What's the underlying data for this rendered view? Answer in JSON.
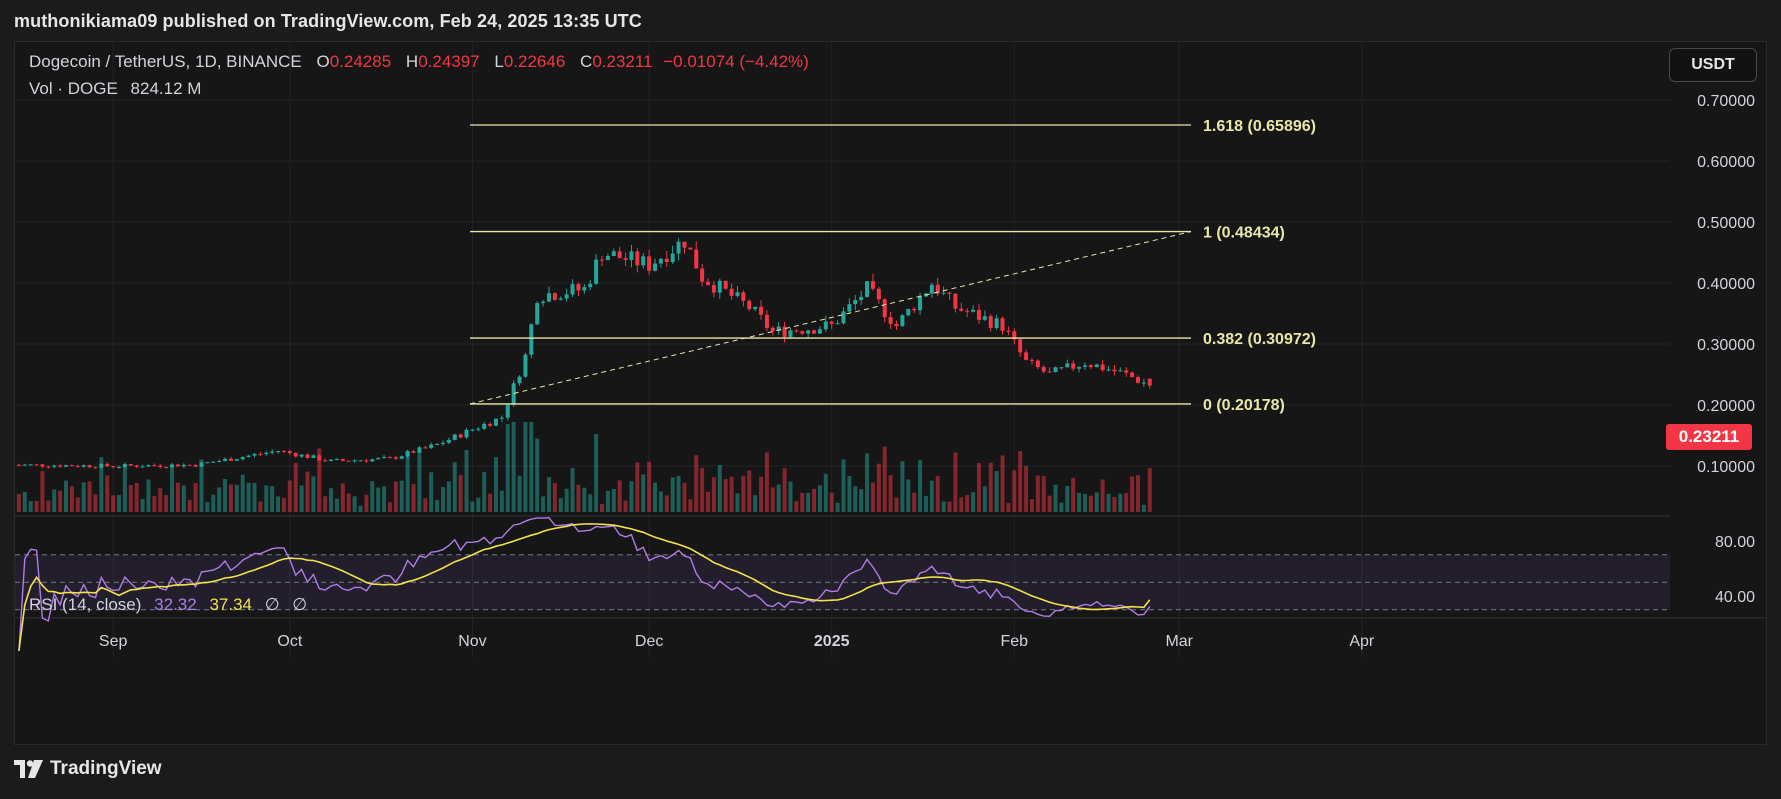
{
  "header": {
    "publish_line": "muthonikiama09 published on TradingView.com, Feb 24, 2025 13:35 UTC"
  },
  "legend": {
    "symbol": "Dogecoin / TetherUS, 1D, BINANCE",
    "open_label": "O",
    "open": "0.24285",
    "high_label": "H",
    "high": "0.24397",
    "low_label": "L",
    "low": "0.22646",
    "close_label": "C",
    "close": "0.23211",
    "change": "−0.01074 (−4.42%)",
    "vol_label": "Vol · DOGE",
    "vol_value": "824.12 M"
  },
  "currency_button": "USDT",
  "last_price": "0.23211",
  "price_axis": [
    "0.70000",
    "0.60000",
    "0.50000",
    "0.40000",
    "0.30000",
    "0.20000",
    "0.10000"
  ],
  "rsi": {
    "label": "RSI (14, close)",
    "value": "32.32",
    "ma": "37.34",
    "extra1": "∅",
    "extra2": "∅",
    "axis": [
      "80.00",
      "40.00"
    ]
  },
  "time_axis": [
    "Sep",
    "Oct",
    "Nov",
    "Dec",
    "2025",
    "Feb",
    "Mar",
    "Apr"
  ],
  "fib_levels": [
    {
      "ratio": "1.618",
      "label": "1.618 (0.65896)",
      "price": 0.65896
    },
    {
      "ratio": "1",
      "label": "1 (0.48434)",
      "price": 0.48434
    },
    {
      "ratio": "0.382",
      "label": "0.382 (0.30972)",
      "price": 0.30972
    },
    {
      "ratio": "0",
      "label": "0 (0.20178)",
      "price": 0.20178
    }
  ],
  "colors": {
    "up": "#26a69a",
    "down": "#f23645",
    "fib": "#e8e6a8",
    "rsi": "#b07ce6",
    "rsi_ma": "#f0e34b"
  },
  "footer": {
    "brand": "TradingView"
  },
  "chart_data": {
    "type": "candlestick",
    "title": "Dogecoin / TetherUS, 1D, BINANCE",
    "ylim": [
      0.02,
      0.72
    ],
    "price_path": [
      {
        "date": "2024-08-15",
        "price": 0.102
      },
      {
        "date": "2024-09-01",
        "price": 0.1
      },
      {
        "date": "2024-09-15",
        "price": 0.102
      },
      {
        "date": "2024-09-29",
        "price": 0.125
      },
      {
        "date": "2024-10-08",
        "price": 0.108
      },
      {
        "date": "2024-10-18",
        "price": 0.112
      },
      {
        "date": "2024-10-26",
        "price": 0.135
      },
      {
        "date": "2024-11-01",
        "price": 0.16
      },
      {
        "date": "2024-11-06",
        "price": 0.18
      },
      {
        "date": "2024-11-10",
        "price": 0.28
      },
      {
        "date": "2024-11-12",
        "price": 0.38
      },
      {
        "date": "2024-11-20",
        "price": 0.39
      },
      {
        "date": "2024-11-23",
        "price": 0.45
      },
      {
        "date": "2024-12-01",
        "price": 0.43
      },
      {
        "date": "2024-12-07",
        "price": 0.47
      },
      {
        "date": "2024-12-10",
        "price": 0.41
      },
      {
        "date": "2024-12-18",
        "price": 0.36
      },
      {
        "date": "2024-12-22",
        "price": 0.32
      },
      {
        "date": "2025-01-01",
        "price": 0.33
      },
      {
        "date": "2025-01-07",
        "price": 0.39
      },
      {
        "date": "2025-01-12",
        "price": 0.33
      },
      {
        "date": "2025-01-18",
        "price": 0.4
      },
      {
        "date": "2025-01-22",
        "price": 0.36
      },
      {
        "date": "2025-01-30",
        "price": 0.33
      },
      {
        "date": "2025-02-03",
        "price": 0.27
      },
      {
        "date": "2025-02-07",
        "price": 0.25
      },
      {
        "date": "2025-02-13",
        "price": 0.27
      },
      {
        "date": "2025-02-20",
        "price": 0.25
      },
      {
        "date": "2025-02-24",
        "price": 0.232
      }
    ],
    "last": {
      "date": "2025-02-24",
      "open": 0.24285,
      "high": 0.24397,
      "low": 0.22646,
      "close": 0.23211,
      "volume": "824.12 M"
    },
    "fibonacci": [
      {
        "ratio": "1.618",
        "price": 0.65896
      },
      {
        "ratio": "1",
        "price": 0.48434
      },
      {
        "ratio": "0.382",
        "price": 0.30972
      },
      {
        "ratio": "0",
        "price": 0.20178
      }
    ],
    "rsi": {
      "period": 14,
      "value": 32.32,
      "ma": 37.34,
      "bands": [
        30,
        50,
        70
      ]
    }
  }
}
